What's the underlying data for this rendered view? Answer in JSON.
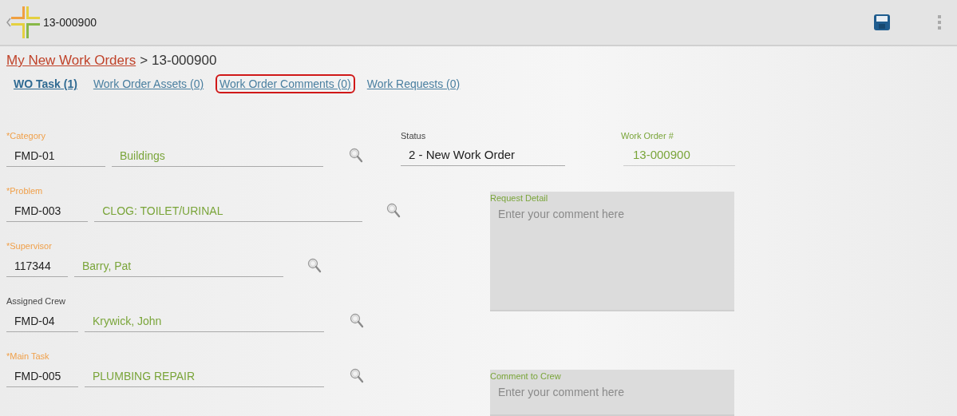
{
  "action_bar": {
    "title": "13-000900"
  },
  "breadcrumb": {
    "link": "My New Work Orders",
    "separator": ">",
    "current": "13-000900"
  },
  "tabs": [
    {
      "label": "WO Task (1)",
      "selected": true,
      "highlighted": false
    },
    {
      "label": "Work Order Assets (0)",
      "selected": false,
      "highlighted": false
    },
    {
      "label": "Work Order Comments (0)",
      "selected": false,
      "highlighted": true
    },
    {
      "label": "Work Requests (0)",
      "selected": false,
      "highlighted": false
    }
  ],
  "lookups": [
    {
      "label": "*Category",
      "required": true,
      "code": "FMD-01",
      "name": "Buildings"
    },
    {
      "label": "*Problem",
      "required": true,
      "code": "FMD-003",
      "name": "CLOG: TOILET/URINAL"
    },
    {
      "label": "*Supervisor",
      "required": true,
      "code": "117344",
      "name": "Barry, Pat"
    },
    {
      "label": "Assigned Crew",
      "required": false,
      "code": "FMD-04",
      "name": "Krywick, John"
    },
    {
      "label": "*Main Task",
      "required": true,
      "code": "FMD-005",
      "name": "PLUMBING REPAIR"
    }
  ],
  "status": {
    "label": "Status",
    "value": "2 - New Work Order"
  },
  "work_order_number": {
    "label": "Work Order #",
    "value": "13-000900"
  },
  "notes": [
    {
      "label": "Request Detail",
      "placeholder": "Enter your comment here"
    },
    {
      "label": "Comment to Crew",
      "placeholder": "Enter your comment here"
    }
  ]
}
